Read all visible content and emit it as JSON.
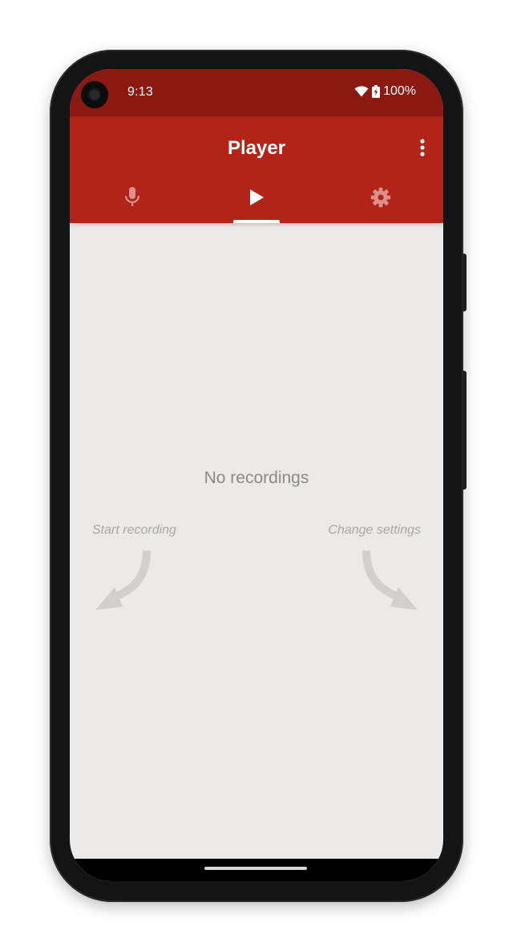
{
  "status_bar": {
    "time": "9:13",
    "battery": "100%",
    "icons": [
      "wifi-icon",
      "battery-charging-icon"
    ]
  },
  "app_bar": {
    "title": "Player",
    "overflow_icon": "more-vert-icon"
  },
  "tabs": [
    {
      "name": "record",
      "icon": "microphone-icon",
      "selected": false
    },
    {
      "name": "player",
      "icon": "play-icon",
      "selected": true
    },
    {
      "name": "settings",
      "icon": "gear-icon",
      "selected": false
    }
  ],
  "empty_state": {
    "title": "No recordings",
    "hint_left": "Start recording",
    "hint_right": "Change settings"
  },
  "colors": {
    "status_bar": "#8b1811",
    "app_bar": "#b22418",
    "background": "#ece9e8",
    "tab_inactive": "#e0908a",
    "tab_active": "#ffffff"
  }
}
